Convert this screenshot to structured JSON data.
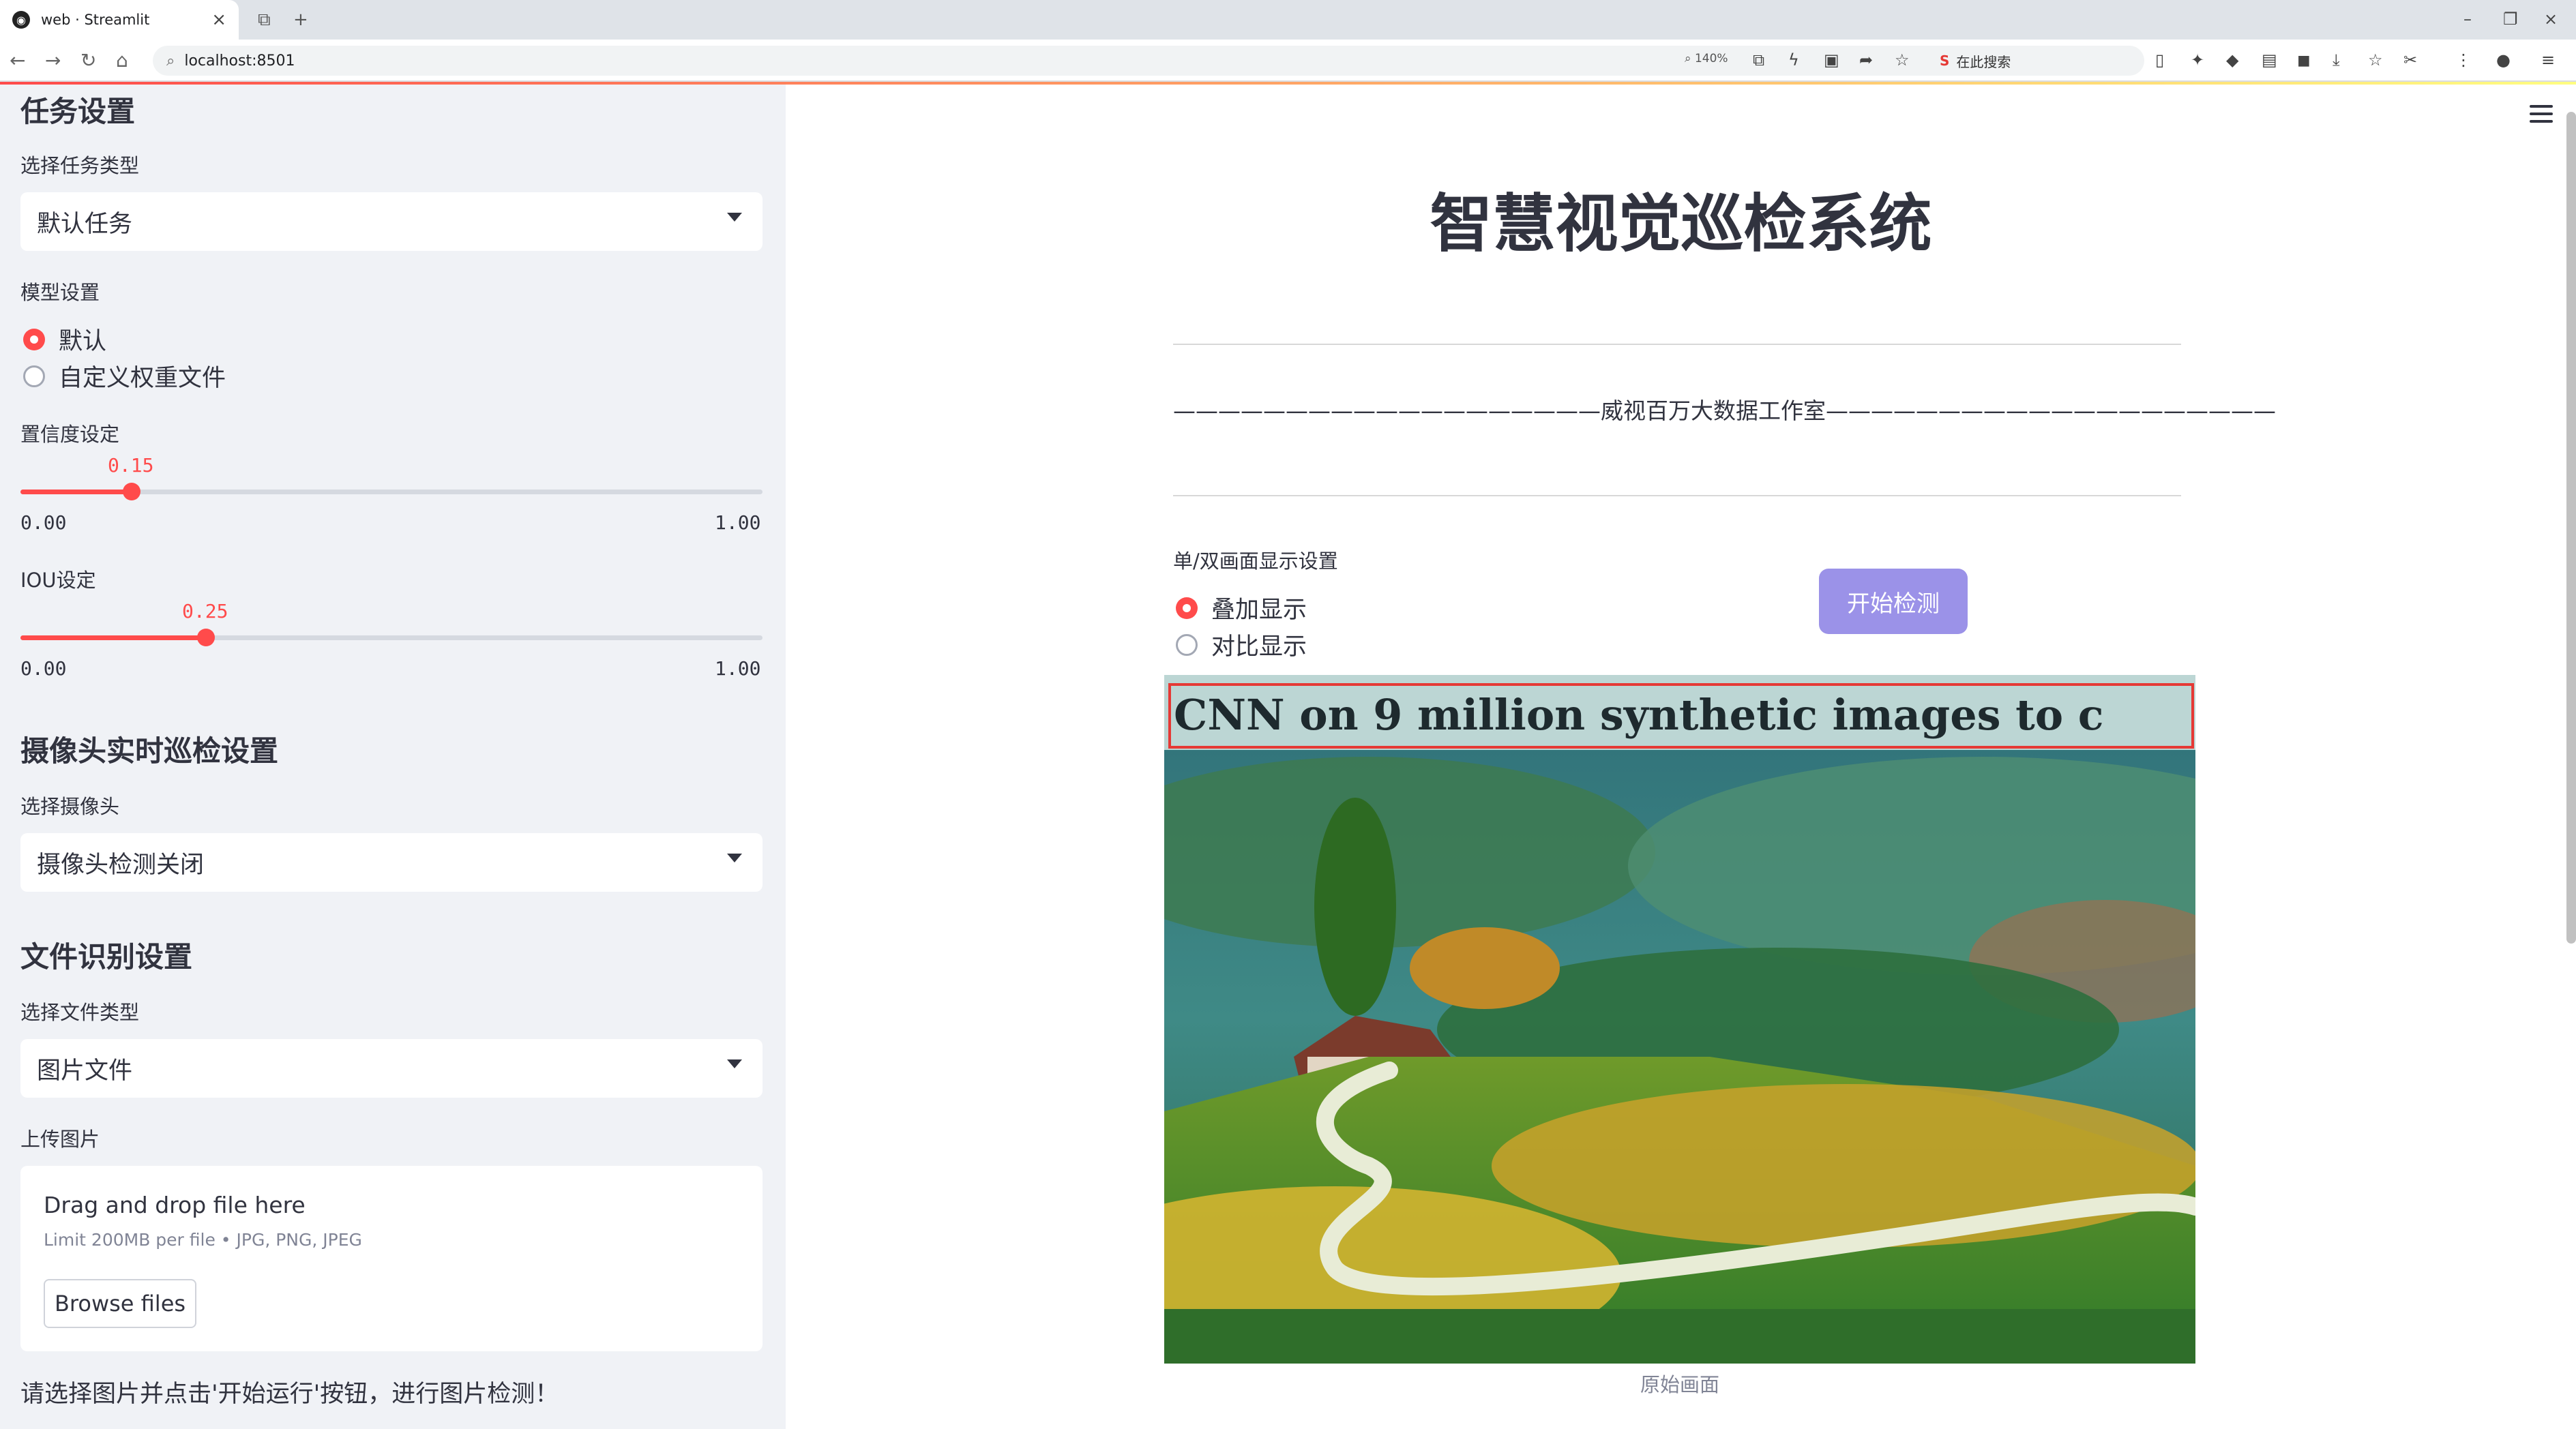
{
  "browser": {
    "tab_title": "web · Streamlit",
    "tab_favicon": "streamlit-icon",
    "url": "localhost:8501",
    "zoom": "140%",
    "search_placeholder": "在此搜索",
    "search_logo": "S"
  },
  "sidebar": {
    "task_heading": "任务设置",
    "task_type_label": "选择任务类型",
    "task_type_value": "默认任务",
    "model_label": "模型设置",
    "model_options": [
      "默认",
      "自定义权重文件"
    ],
    "model_selected": 0,
    "conf_label": "置信度设定",
    "conf": {
      "value": "0.15",
      "min": "0.00",
      "max": "1.00",
      "fraction": 0.15
    },
    "iou_label": "IOU设定",
    "iou": {
      "value": "0.25",
      "min": "0.00",
      "max": "1.00",
      "fraction": 0.25
    },
    "camera_heading": "摄像头实时巡检设置",
    "camera_label": "选择摄像头",
    "camera_value": "摄像头检测关闭",
    "file_heading": "文件识别设置",
    "file_type_label": "选择文件类型",
    "file_type_value": "图片文件",
    "upload_label": "上传图片",
    "drop_text": "Drag and drop file here",
    "limit_text": "Limit 200MB per file • JPG, PNG, JPEG",
    "browse_label": "Browse files",
    "hint": "请选择图片并点击'开始运行'按钮，进行图片检测！"
  },
  "main": {
    "title": "智慧视觉巡检系统",
    "studio_line": "———————————————————威视百万大数据工作室————————————————————",
    "display_label": "单/双画面显示设置",
    "display_options": [
      "叠加显示",
      "对比显示"
    ],
    "display_selected": 0,
    "start_button": "开始检测",
    "image_text": "CNN on 9 million synthetic images to c",
    "caption": "原始画面"
  },
  "colors": {
    "accent": "#ff4b4b",
    "sidebar_bg": "#f0f2f6",
    "button_bg": "#9b92e8",
    "detection_box": "#e53935"
  }
}
